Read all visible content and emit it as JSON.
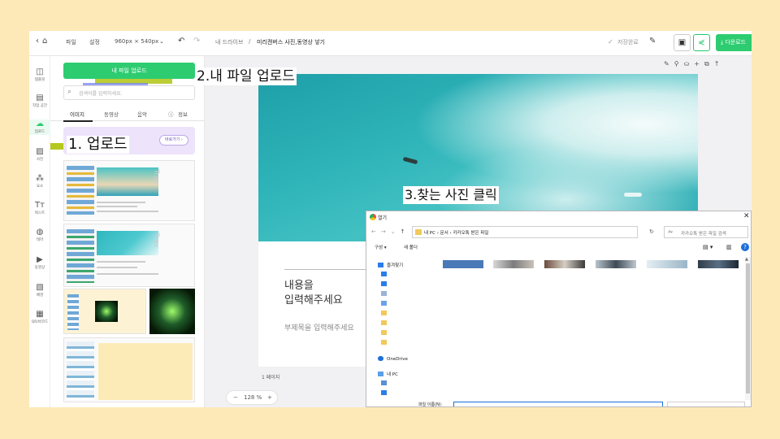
{
  "topbar": {
    "menu_file": "파일",
    "menu_settings": "설정",
    "canvas_size": "960px × 540px",
    "breadcrumb_drive": "내 드라이브",
    "breadcrumb_sep": "/",
    "doc_title": "미리캔버스 사진,동영상 넣기",
    "save_status": "저장완료",
    "download_label": "다운로드"
  },
  "iconbar": {
    "items": [
      {
        "label": "템플릿",
        "icon": "layout-icon"
      },
      {
        "label": "작업 공간",
        "icon": "workspace-icon"
      },
      {
        "label": "업로드",
        "icon": "cloud-upload-icon"
      },
      {
        "label": "사진",
        "icon": "photo-icon"
      },
      {
        "label": "요소",
        "icon": "elements-icon"
      },
      {
        "label": "텍스트",
        "icon": "text-icon"
      },
      {
        "label": "테마",
        "icon": "palette-icon"
      },
      {
        "label": "동영상",
        "icon": "play-icon"
      },
      {
        "label": "배경",
        "icon": "background-icon"
      },
      {
        "label": "QR/바코드",
        "icon": "qr-icon"
      }
    ]
  },
  "panel": {
    "upload_button": "내 파일 업로드",
    "search_placeholder": "검색어를 입력하세요.",
    "tabs": [
      "이미지",
      "동영상",
      "음악",
      "정보"
    ],
    "promo_button": "바로가기"
  },
  "canvas": {
    "title_line1": "내용을",
    "title_line2": "입력해주세요",
    "subtitle": "부제목을 입력해주세요",
    "zoom_minus": "−",
    "zoom_value": "128 %",
    "zoom_plus": "+",
    "page_label": "1 페이지"
  },
  "dialog": {
    "title": "열기",
    "close": "✕",
    "breadcrumb": "내 PC  ›  문서  ›  카카오톡 받은 파일",
    "search_placeholder": "카카오톡 받은 파일 검색",
    "organize": "구성 ▾",
    "new_folder": "새 폴더",
    "tree_items": [
      "즐겨찾기",
      "",
      "",
      "",
      "",
      "",
      "",
      "",
      "",
      "",
      "OneDrive",
      "내 PC",
      "",
      ""
    ],
    "filename_label": "파일 이름(N):"
  },
  "annotations": {
    "step1": "1. 업로드",
    "step2": "2.내 파일 업로드",
    "step3": "3.찾는 사진 클릭"
  },
  "colors": {
    "accent_green": "#2ecc71",
    "page_background": "#fde9b8",
    "highlighter": "#b5c81f"
  }
}
